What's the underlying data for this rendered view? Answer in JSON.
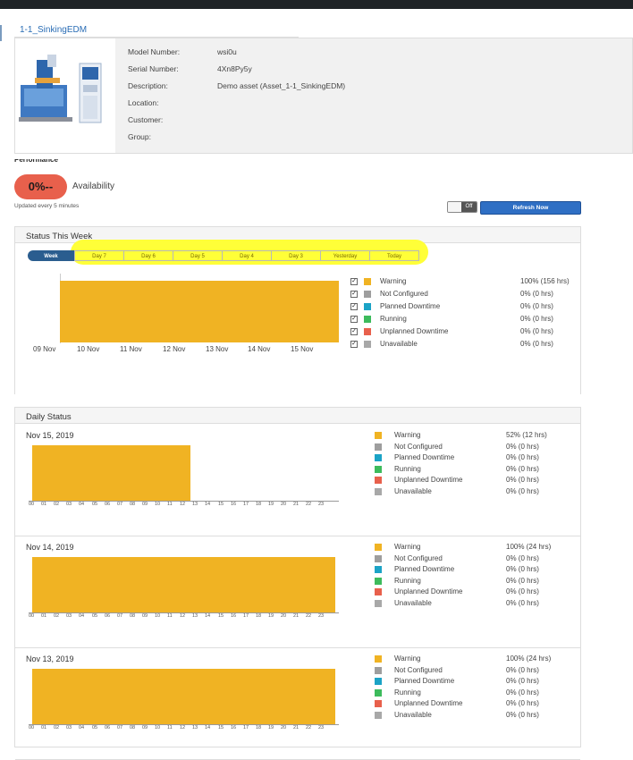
{
  "asset": {
    "title": "1-1_SinkingEDM",
    "fields": [
      {
        "label": "Model Number:",
        "value": "wsi0u"
      },
      {
        "label": "Serial Number:",
        "value": "4Xn8Py5y"
      },
      {
        "label": "Description:",
        "value": "Demo asset (Asset_1-1_SinkingEDM)"
      },
      {
        "label": "Location:",
        "value": ""
      },
      {
        "label": "Customer:",
        "value": ""
      },
      {
        "label": "Group:",
        "value": ""
      }
    ]
  },
  "performance": {
    "heading": "Performance",
    "availability_value": "0%--",
    "availability_label": "Availability",
    "updated_note": "Updated every 5 minutes",
    "toggle_label": "Off",
    "refresh_label": "Refresh Now"
  },
  "week": {
    "title": "Status This Week",
    "tabs": [
      "Week",
      "Day 7",
      "Day 6",
      "Day 5",
      "Day 4",
      "Day 3",
      "Yesterday",
      "Today"
    ],
    "x_ticks": [
      "09 Nov",
      "10 Nov",
      "11 Nov",
      "12 Nov",
      "13 Nov",
      "14 Nov",
      "15 Nov"
    ],
    "legend": [
      {
        "name": "Warning",
        "color": "#f0b323",
        "value": "100% (156 hrs)"
      },
      {
        "name": "Not Configured",
        "color": "#9e9e9e",
        "value": "0% (0 hrs)"
      },
      {
        "name": "Planned Downtime",
        "color": "#1ba3c6",
        "value": "0% (0 hrs)"
      },
      {
        "name": "Running",
        "color": "#3dbb5c",
        "value": "0% (0 hrs)"
      },
      {
        "name": "Unplanned Downtime",
        "color": "#e8604c",
        "value": "0% (0 hrs)"
      },
      {
        "name": "Unavailable",
        "color": "#a8a8a8",
        "value": "0% (0 hrs)"
      }
    ]
  },
  "daily": {
    "title": "Daily Status",
    "hours": [
      "00",
      "01",
      "02",
      "03",
      "04",
      "05",
      "06",
      "07",
      "08",
      "09",
      "10",
      "11",
      "12",
      "13",
      "14",
      "15",
      "16",
      "17",
      "18",
      "19",
      "20",
      "21",
      "22",
      "23"
    ],
    "days": [
      {
        "date": "Nov 15, 2019",
        "warning_hours": 12.5,
        "legend": [
          {
            "name": "Warning",
            "color": "#f0b323",
            "value": "52% (12 hrs)"
          },
          {
            "name": "Not Configured",
            "color": "#9e9e9e",
            "value": "0% (0 hrs)"
          },
          {
            "name": "Planned Downtime",
            "color": "#1ba3c6",
            "value": "0% (0 hrs)"
          },
          {
            "name": "Running",
            "color": "#3dbb5c",
            "value": "0% (0 hrs)"
          },
          {
            "name": "Unplanned Downtime",
            "color": "#e8604c",
            "value": "0% (0 hrs)"
          },
          {
            "name": "Unavailable",
            "color": "#a8a8a8",
            "value": "0% (0 hrs)"
          }
        ]
      },
      {
        "date": "Nov 14, 2019",
        "warning_hours": 24,
        "legend": [
          {
            "name": "Warning",
            "color": "#f0b323",
            "value": "100% (24 hrs)"
          },
          {
            "name": "Not Configured",
            "color": "#9e9e9e",
            "value": "0% (0 hrs)"
          },
          {
            "name": "Planned Downtime",
            "color": "#1ba3c6",
            "value": "0% (0 hrs)"
          },
          {
            "name": "Running",
            "color": "#3dbb5c",
            "value": "0% (0 hrs)"
          },
          {
            "name": "Unplanned Downtime",
            "color": "#e8604c",
            "value": "0% (0 hrs)"
          },
          {
            "name": "Unavailable",
            "color": "#a8a8a8",
            "value": "0% (0 hrs)"
          }
        ]
      },
      {
        "date": "Nov 13, 2019",
        "warning_hours": 24,
        "legend": [
          {
            "name": "Warning",
            "color": "#f0b323",
            "value": "100% (24 hrs)"
          },
          {
            "name": "Not Configured",
            "color": "#9e9e9e",
            "value": "0% (0 hrs)"
          },
          {
            "name": "Planned Downtime",
            "color": "#1ba3c6",
            "value": "0% (0 hrs)"
          },
          {
            "name": "Running",
            "color": "#3dbb5c",
            "value": "0% (0 hrs)"
          },
          {
            "name": "Unplanned Downtime",
            "color": "#e8604c",
            "value": "0% (0 hrs)"
          },
          {
            "name": "Unavailable",
            "color": "#a8a8a8",
            "value": "0% (0 hrs)"
          }
        ]
      }
    ]
  }
}
